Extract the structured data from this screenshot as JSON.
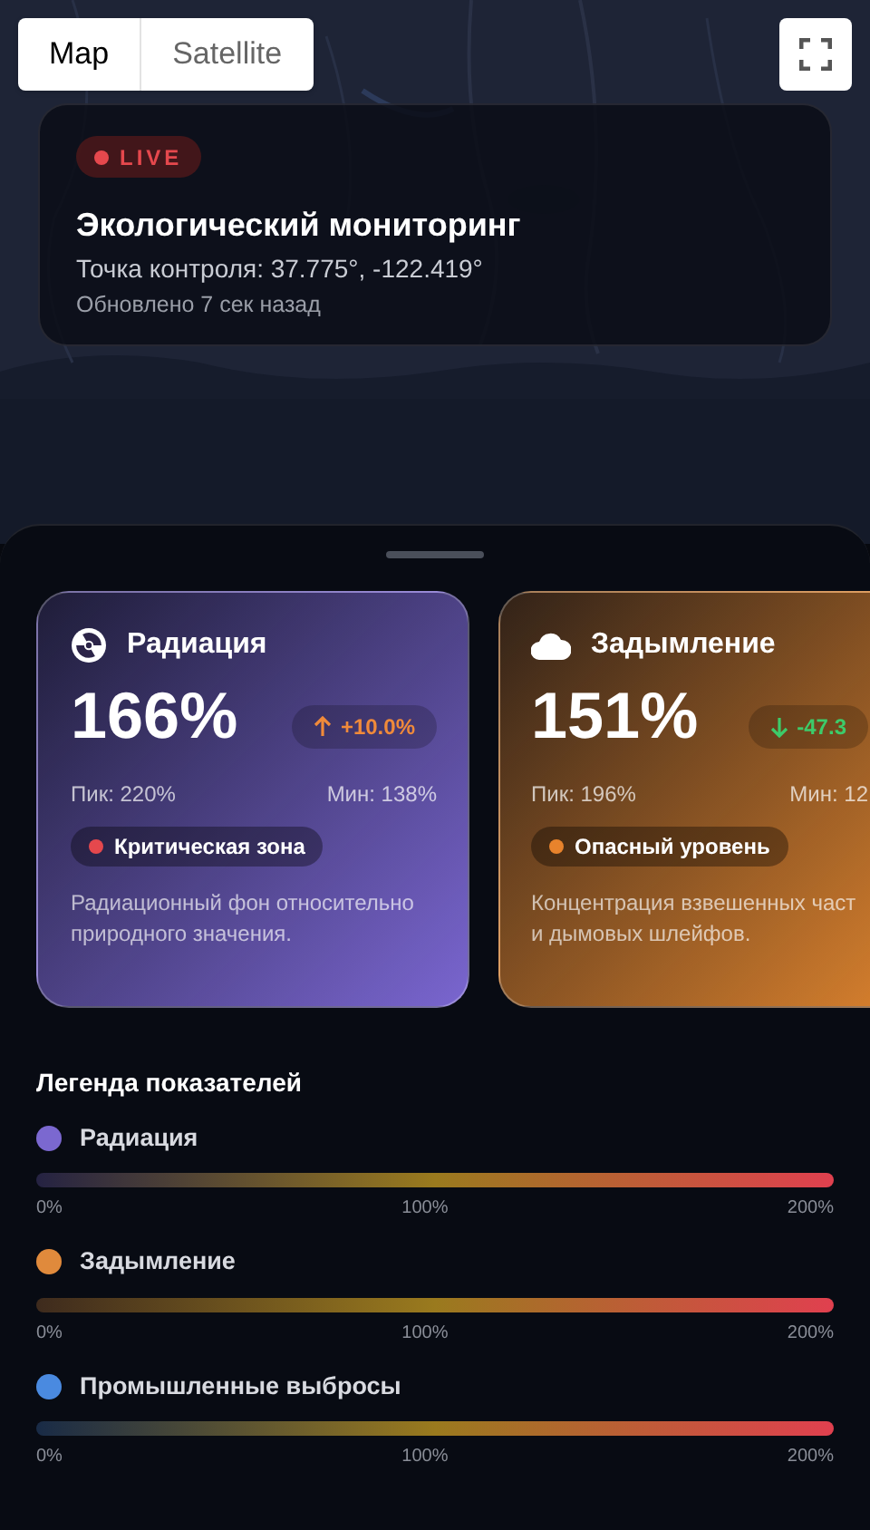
{
  "map_type_toggle": [
    {
      "label": "Map",
      "selected": true
    },
    {
      "label": "Satellite",
      "selected": false
    }
  ],
  "header": {
    "live_badge": "LIVE",
    "title": "Экологический мониторинг",
    "coordinates": "Точка контроля: 37.775°, -122.419°",
    "updated": "Обновлено 7 сек назад"
  },
  "cards": [
    {
      "kind": "radiation",
      "title": "Радиация",
      "value": "166%",
      "trend": {
        "kind": "up",
        "text": "+10.0%"
      },
      "peak": "Пик: 220%",
      "min": "Мин: 138%",
      "status": {
        "text": "Критическая зона",
        "color": "#e5484d"
      },
      "description": "Радиационный фон относительно\nприродного значения.",
      "color": "#7a66d0"
    },
    {
      "kind": "smoke",
      "title": "Задымление",
      "value": "151%",
      "trend": {
        "kind": "down",
        "text": "-47.3"
      },
      "peak": "Пик: 196%",
      "min": "Мин: 12",
      "status": {
        "text": "Опасный уровень",
        "color": "#e8832c"
      },
      "description": "Концентрация взвешенных част\nи дымовых шлейфов.",
      "color": "#d9812e"
    }
  ],
  "legend": {
    "title": "Легенда показателей",
    "items": [
      {
        "name": "Радиация",
        "color": "#7b68d0",
        "ticks": [
          "0%",
          "100%",
          "200%"
        ]
      },
      {
        "name": "Задымление",
        "color": "#e08a3c",
        "ticks": [
          "0%",
          "100%",
          "200%"
        ]
      },
      {
        "name": "Промышленные выбросы",
        "color": "#4a8ae0",
        "ticks": [
          "0%",
          "100%",
          "200%"
        ]
      }
    ]
  }
}
